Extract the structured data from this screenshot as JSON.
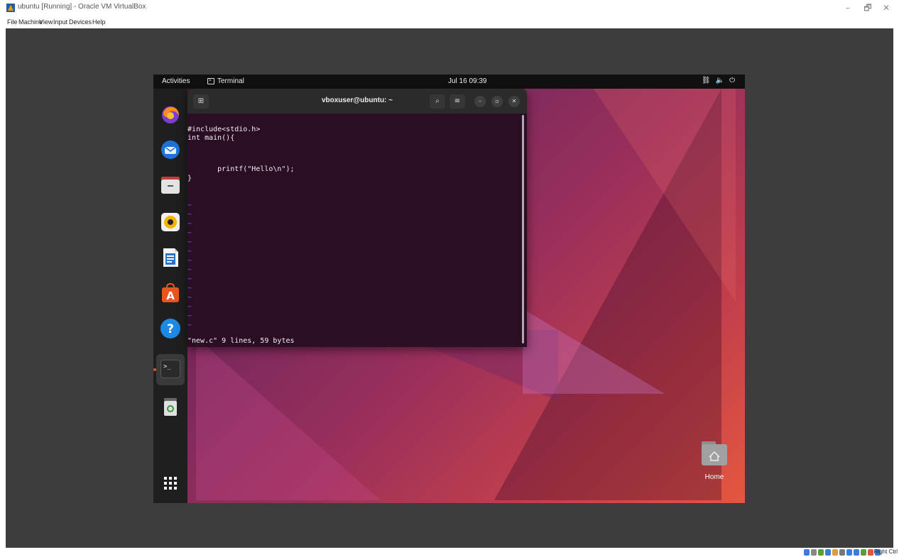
{
  "host": {
    "title": "ubuntu [Running] - Oracle VM VirtualBox",
    "controls": {
      "minimize": "–",
      "restore": "🗗",
      "close": "✕"
    },
    "menu": [
      "File",
      "Machine",
      "View",
      "Input",
      "Devices",
      "Help"
    ],
    "status_right": "Right Ctrl"
  },
  "guest": {
    "topbar": {
      "activities": "Activities",
      "app_name": "Terminal",
      "clock": "Jul 16  09:39"
    },
    "dock": {
      "items": [
        {
          "name": "firefox"
        },
        {
          "name": "thunderbird"
        },
        {
          "name": "files"
        },
        {
          "name": "rhythmbox"
        },
        {
          "name": "libreoffice-writer"
        },
        {
          "name": "app-center"
        },
        {
          "name": "help",
          "glyph": "?"
        },
        {
          "name": "terminal",
          "glyph": ">_"
        },
        {
          "name": "trash"
        },
        {
          "name": "show-apps"
        }
      ]
    },
    "terminal": {
      "title": "vboxuser@ubuntu: ~",
      "lines": [
        "#include<stdio.h>",
        "int main(){",
        "",
        "",
        "       printf(\"Hello\\n\");",
        "}"
      ],
      "tilde": "~",
      "status_line": "\"new.c\" 9 lines, 59 bytes"
    },
    "desktop": {
      "home_label": "Home"
    }
  }
}
